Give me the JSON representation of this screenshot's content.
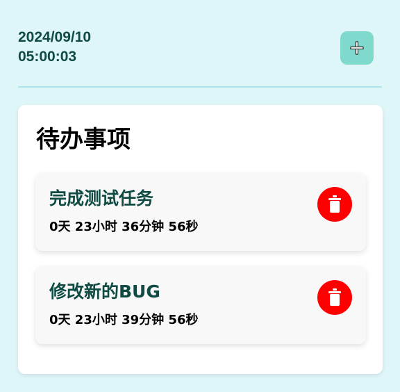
{
  "header": {
    "date": "2024/09/10",
    "time": "05:00:03",
    "add_icon": "plus-icon"
  },
  "todo": {
    "title": "待办事项",
    "items": [
      {
        "title": "完成测试任务",
        "countdown": "0天 23小时 36分钟 56秒",
        "delete_icon": "trash-icon"
      },
      {
        "title": "修改新的BUG",
        "countdown": "0天 23小时 39分钟 56秒",
        "delete_icon": "trash-icon"
      }
    ]
  },
  "colors": {
    "background": "#dff6f8",
    "accent": "#7fd9cc",
    "title_text": "#0f4a43",
    "delete": "#ff0000"
  }
}
